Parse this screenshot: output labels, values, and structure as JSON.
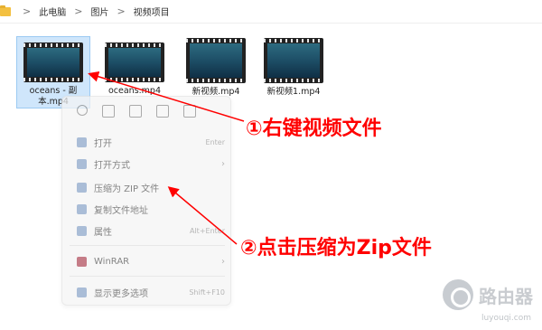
{
  "breadcrumb": {
    "items": [
      "此电脑",
      "图片",
      "视频项目"
    ],
    "separator": ">"
  },
  "files": [
    {
      "name": "oceans - 副本.mp4",
      "selected": true
    },
    {
      "name": "oceans.mp4",
      "selected": false
    },
    {
      "name": "新视频.mp4",
      "selected": false
    },
    {
      "name": "新视频1.mp4",
      "selected": false
    }
  ],
  "context_menu": {
    "quick_actions": [
      "cut-icon",
      "copy-icon",
      "rename-icon",
      "share-icon",
      "delete-icon"
    ],
    "items": [
      {
        "label": "打开",
        "shortcut": "Enter",
        "has_submenu": false
      },
      {
        "label": "打开方式",
        "shortcut": "",
        "has_submenu": true
      },
      {
        "label": "压缩为 ZIP 文件",
        "shortcut": "",
        "has_submenu": false
      },
      {
        "label": "复制文件地址",
        "shortcut": "",
        "has_submenu": false
      },
      {
        "label": "属性",
        "shortcut": "Alt+Enter",
        "has_submenu": false
      },
      {
        "label": "WinRAR",
        "shortcut": "",
        "has_submenu": true
      },
      {
        "label": "显示更多选项",
        "shortcut": "Shift+F10",
        "has_submenu": false
      }
    ]
  },
  "annotations": {
    "step1": "①右键视频文件",
    "step2": "②点击压缩为Zip文件"
  },
  "watermark": {
    "brand": "路由器",
    "site": "luyouqi.com"
  },
  "colors": {
    "annotation": "#ff0000",
    "selection_bg": "#cfe6fb",
    "selection_border": "#9ccaf2",
    "folder": "#f3c040"
  }
}
